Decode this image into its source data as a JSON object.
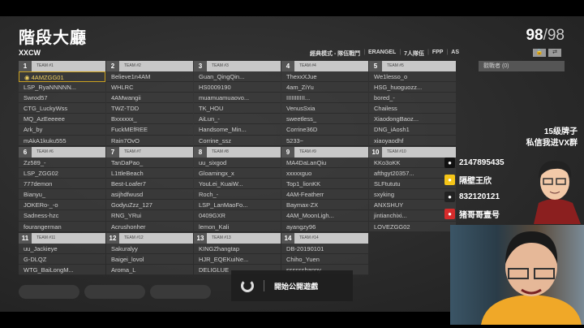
{
  "header": {
    "title": "階段大廳",
    "lobby_name": "XXCW",
    "players_current": "98",
    "players_max": "/98"
  },
  "mode": [
    "經典模式 - 隊伍戰鬥",
    "ERANGEL",
    "7人隊伍",
    "FPP",
    "AS"
  ],
  "lock_icons": [
    "lock-icon",
    "toggle-icon"
  ],
  "spectators": "觀戰者 (0)",
  "teams": [
    {
      "num": "1",
      "name": "TEAM #1",
      "players": [
        "4AMZGG01",
        "LSP_RyaNNNNN...",
        "Swrod57",
        "CTG_LuckyWss",
        "MQ_AzEeeeee",
        "Ark_by",
        "mAkA1kuku555"
      ]
    },
    {
      "num": "2",
      "name": "TEAM #2",
      "players": [
        "Believe1n4AM",
        "WHLRC",
        "4AMwangii",
        "TWZ-TDD",
        "Bxxxxxx_",
        "FuckMEfREE",
        "Rain7OvO"
      ]
    },
    {
      "num": "3",
      "name": "TEAM #3",
      "players": [
        "Guan_QingQin...",
        "HS0009190",
        "muamuamuaovo...",
        "TK_HOU",
        "AiLun_-",
        "Handsome_Min...",
        "Corrine_ssz"
      ]
    },
    {
      "num": "4",
      "name": "TEAM #4",
      "players": [
        "ThexxXJue",
        "4am_ZiYu",
        "IIIIIIIIIII...",
        "VenusSxia",
        "sweetless_",
        "Corrine36D",
        "5233~"
      ]
    },
    {
      "num": "5",
      "name": "TEAM #5",
      "players": [
        "We1lesso_o",
        "HSG_huoguozz...",
        "bored_-",
        "Chailess",
        "XiaodongBaoz...",
        "DNG_iAosh1",
        "xiaoyaodhf"
      ]
    },
    {
      "num": "6",
      "name": "TEAM #6",
      "players": [
        "Zz589_-",
        "LSP_ZGG02",
        "777demon",
        "Bianyu_",
        "JOKERo-_-o",
        "Sadness-hzc",
        "fourangerman"
      ]
    },
    {
      "num": "7",
      "name": "TEAM #7",
      "players": [
        "TanDaPao_",
        "L1ttleBeach",
        "Best-Loafer7",
        "asijhdfwusd",
        "GodyuZzz_127",
        "RNG_YRui",
        "Acrushonher"
      ]
    },
    {
      "num": "8",
      "name": "TEAM #8",
      "players": [
        "uu_sixgod",
        "Gloamingx_x",
        "YouLei_KuaiW...",
        "Roch_-",
        "LSP_LanMaoFo...",
        "0409GXR",
        "lemon_Kali"
      ]
    },
    {
      "num": "9",
      "name": "TEAM #9",
      "players": [
        "MA4DaLanQiu",
        "xxxxxguo",
        "Top1_lionKK",
        "4AM-Featherr",
        "Baymax-ZX",
        "4AM_MoonLigh...",
        "ayangzy96"
      ]
    },
    {
      "num": "10",
      "name": "TEAM #10",
      "players": [
        "KKo3oKK",
        "afthgyt20357...",
        "SLFtututu",
        "sxyking",
        "ANXSHUY",
        "jintianchixi...",
        "LOVEZGG02"
      ]
    },
    {
      "num": "11",
      "name": "TEAM #11",
      "players": [
        "uu_Jackieye",
        "G-DLQZ",
        "WTG_BaiLongM..."
      ]
    },
    {
      "num": "12",
      "name": "TEAM #12",
      "players": [
        "Sakuralyy",
        "Baigei_lovol",
        "Aroma_L"
      ]
    },
    {
      "num": "13",
      "name": "TEAM #13",
      "players": [
        "KINGZhangtap",
        "HJR_EQEKuiNe...",
        "DELIGLUE"
      ]
    },
    {
      "num": "14",
      "name": "TEAM #14",
      "players": [
        "DB-20190101",
        "Chiho_Yuen",
        "ssssssbanny"
      ]
    }
  ],
  "toast": {
    "text": "開始公開遊戲"
  },
  "overlay": {
    "promo_line1": "15级牌子",
    "promo_line2": "私信我进VX群",
    "social": [
      {
        "icon": "tiktok-icon",
        "text": "2147895435",
        "color": "#111111"
      },
      {
        "icon": "weibo-icon",
        "text": "隔壁王欣",
        "color": "#f5c518"
      },
      {
        "icon": "qq-icon",
        "text": "832120121",
        "color": "#222222"
      },
      {
        "icon": "netease-music-icon",
        "text": "猪哥哥壹号",
        "color": "#d52b2b"
      }
    ]
  }
}
